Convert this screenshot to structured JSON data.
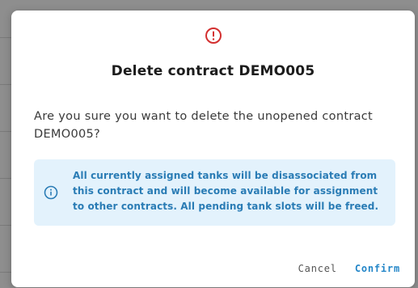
{
  "dialog": {
    "icon": "alert-circle-icon",
    "title": "Delete contract DEMO005",
    "message": "Are you sure you want to delete the unopened contract DEMO005?",
    "info": {
      "icon": "info-circle-icon",
      "text": "All currently assigned tanks will be disassociated from this contract and will become available for assignment to other contracts. All pending tank slots will be freed."
    },
    "actions": {
      "cancel_label": "Cancel",
      "confirm_label": "Confirm"
    }
  },
  "colors": {
    "alert": "#d32f2f",
    "info_bg": "#e3f2fc",
    "info_text": "#2a7cb5",
    "confirm": "#2386c8"
  }
}
